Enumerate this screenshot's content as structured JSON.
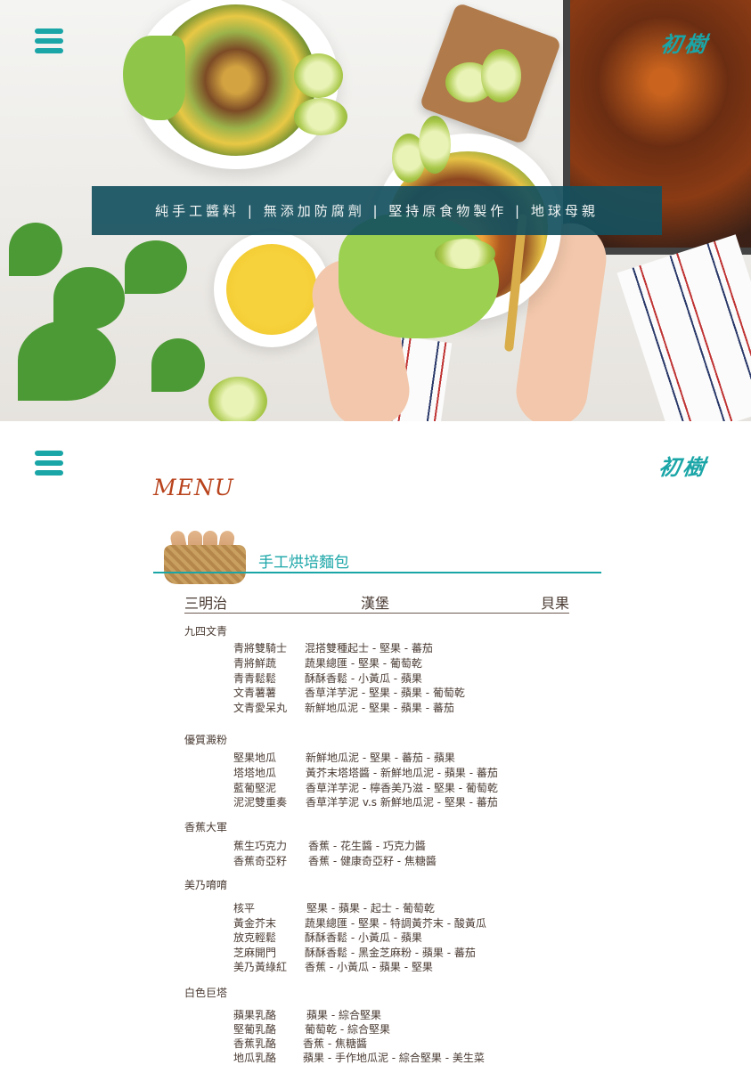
{
  "header": {
    "menu_icon": "hamburger-icon",
    "logo_text": "初樹",
    "banner": "純手工醬料 | 無添加防腐劑 | 堅持原食物製作 | 地球母親"
  },
  "menu": {
    "title": "MENU",
    "section": {
      "icon": "bread-basket-icon",
      "title": "手工烘培麵包"
    },
    "columns": [
      "三明治",
      "漢堡",
      "貝果"
    ],
    "groups": [
      {
        "title": "九四文青",
        "items": [
          {
            "name": "青將雙騎士",
            "desc": "混搭雙種起士 - 堅果 - 蕃茄"
          },
          {
            "name": "青將鮮蔬",
            "desc": "蔬果總匯 - 堅果 - 葡萄乾"
          },
          {
            "name": "青青鬆鬆",
            "desc": "酥酥香鬆 - 小黃瓜 - 蘋果"
          },
          {
            "name": "文青薯薯",
            "desc": "香草洋芋泥 - 堅果 - 蘋果 - 葡萄乾"
          },
          {
            "name": "文青愛呆丸",
            "desc": "新鮮地瓜泥 - 堅果 - 蘋果  - 蕃茄"
          }
        ]
      },
      {
        "title": "優質澱粉",
        "items": [
          {
            "name": "堅果地瓜",
            "desc": "新鮮地瓜泥 - 堅果 - 蕃茄 - 蘋果"
          },
          {
            "name": "塔塔地瓜",
            "desc": "黃芥末塔塔醬 - 新鮮地瓜泥 - 蘋果  - 蕃茄"
          },
          {
            "name": "藍葡堅泥",
            "desc": "香草洋芋泥 - 檸香美乃滋 - 堅果 - 葡萄乾"
          },
          {
            "name": "泥泥雙重奏",
            "desc": "香草洋芋泥 v.s 新鮮地瓜泥 - 堅果 - 蕃茄"
          }
        ]
      },
      {
        "title": "香蕉大軍",
        "items": [
          {
            "name": "蕉生巧克力",
            "desc": "香蕉 - 花生醬 - 巧克力醬"
          },
          {
            "name": "香蕉奇亞籽",
            "desc": "香蕉 - 健康奇亞籽 - 焦糖醬"
          }
        ]
      },
      {
        "title": "美乃唷唷",
        "items": [
          {
            "name": "核平",
            "desc": "堅果 - 蘋果 - 起士 - 葡萄乾"
          },
          {
            "name": "黃金芥末",
            "desc": "蔬果總匯  - 堅果  - 特調黃芥末 - 酸黃瓜"
          },
          {
            "name": "放克輕鬆",
            "desc": "酥酥香鬆 - 小黃瓜 - 蘋果"
          },
          {
            "name": "芝麻開門",
            "desc": "酥酥香鬆 - 黑金芝麻粉 - 蘋果 - 蕃茄"
          },
          {
            "name": "美乃黃綠紅",
            "desc": "香蕉 - 小黃瓜 - 蘋果 - 堅果"
          }
        ]
      },
      {
        "title": "白色巨塔",
        "items": [
          {
            "name": "蘋果乳酪",
            "desc": "蘋果 - 綜合堅果"
          },
          {
            "name": "堅葡乳酪",
            "desc": "葡萄乾 - 綜合堅果"
          },
          {
            "name": "香蕉乳酪",
            "desc": "香蕉 - 焦糖醬"
          },
          {
            "name": "地瓜乳酪",
            "desc": "蘋果 - 手作地瓜泥 - 綜合堅果 - 美生菜"
          }
        ]
      }
    ]
  }
}
